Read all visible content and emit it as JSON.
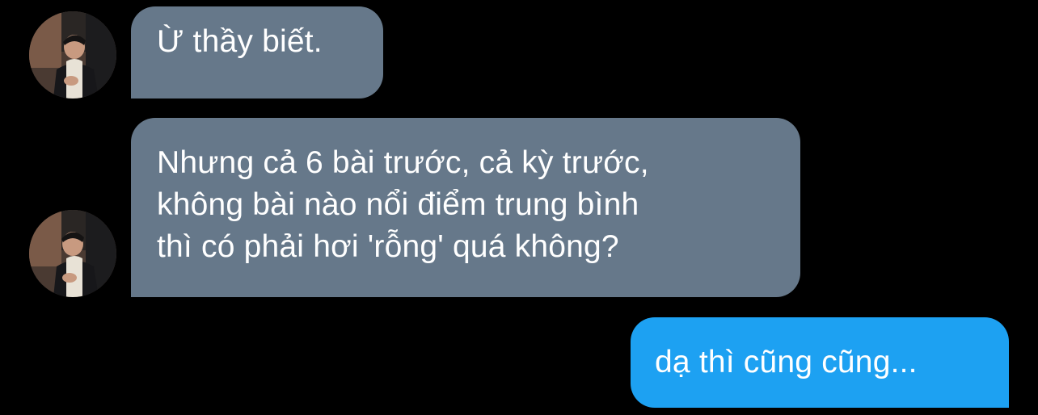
{
  "conversation": {
    "messages": [
      {
        "direction": "incoming",
        "avatar_icon": "user-photo-avatar",
        "lines": [
          "Ừ thầy biết."
        ]
      },
      {
        "direction": "incoming",
        "avatar_icon": "user-photo-avatar",
        "lines": [
          "Nhưng cả 6 bài trước, cả kỳ trước,",
          "không bài nào nổi điểm trung bình",
          "thì có phải hơi 'rỗng' quá không?"
        ]
      },
      {
        "direction": "outgoing",
        "lines": [
          "dạ thì cũng cũng..."
        ]
      }
    ]
  },
  "colors": {
    "background": "#000000",
    "incoming_bubble": "#66788a",
    "outgoing_bubble": "#1da1f2",
    "text": "#ffffff"
  }
}
